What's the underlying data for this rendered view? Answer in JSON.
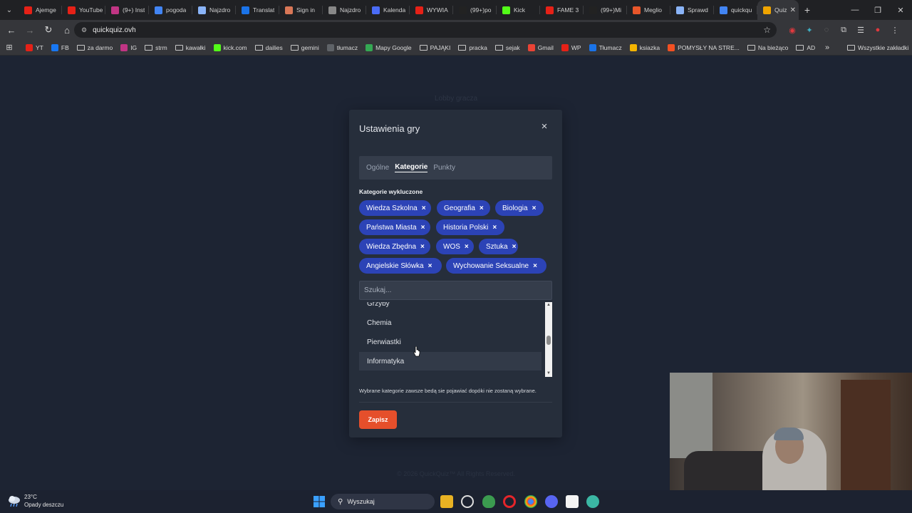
{
  "browser": {
    "tabs": [
      {
        "title": "Ajemge",
        "icon": "youtube-icon",
        "color": "#e62117"
      },
      {
        "title": "YouTube",
        "icon": "youtube-icon",
        "color": "#e62117"
      },
      {
        "title": "(9+) Inst",
        "icon": "instagram-icon",
        "color": "#c13584"
      },
      {
        "title": "pogoda",
        "icon": "google-icon",
        "color": "#4285f4"
      },
      {
        "title": "Najzdro",
        "icon": "gemini-icon",
        "color": "#8ab4f8"
      },
      {
        "title": "Translat",
        "icon": "translate-icon",
        "color": "#1a73e8"
      },
      {
        "title": "Sign in",
        "icon": "asterisk-icon",
        "color": "#d97757"
      },
      {
        "title": "Najzdro",
        "icon": "openai-icon",
        "color": "#888888"
      },
      {
        "title": "Kalenda",
        "icon": "calendar-icon",
        "color": "#4a6cf7"
      },
      {
        "title": "WYWIA",
        "icon": "youtube-icon",
        "color": "#e62117"
      },
      {
        "title": "(99+)po",
        "icon": "tiktok-icon",
        "color": "#222222"
      },
      {
        "title": "Kick",
        "icon": "kick-icon",
        "color": "#53fc18"
      },
      {
        "title": "FAME 3",
        "icon": "youtube-icon",
        "color": "#e62117"
      },
      {
        "title": "(99+)Mi",
        "icon": "tiktok-icon",
        "color": "#222222"
      },
      {
        "title": "Meglio",
        "icon": "letter-c-icon",
        "color": "#e8562a"
      },
      {
        "title": "Sprawd",
        "icon": "gemini-icon",
        "color": "#8ab4f8"
      },
      {
        "title": "quickqu",
        "icon": "google-icon",
        "color": "#4285f4"
      },
      {
        "title": "Quiz",
        "icon": "question-icon",
        "color": "#f0a500",
        "active": true
      }
    ],
    "address": "quickquiz.ovh",
    "bookmarks": [
      {
        "label": "YT",
        "icon": "youtube-icon",
        "color": "#e62117"
      },
      {
        "label": "FB",
        "icon": "facebook-icon",
        "color": "#1877f2"
      },
      {
        "label": "za darmo",
        "icon": "folder-icon"
      },
      {
        "label": "IG",
        "icon": "instagram-icon",
        "color": "#c13584"
      },
      {
        "label": "strm",
        "icon": "folder-icon"
      },
      {
        "label": "kawałki",
        "icon": "folder-icon"
      },
      {
        "label": "kick.com",
        "icon": "kick-icon",
        "color": "#53fc18"
      },
      {
        "label": "dailies",
        "icon": "folder-icon"
      },
      {
        "label": "gemini",
        "icon": "folder-icon"
      },
      {
        "label": "tłumacz",
        "icon": "translate-icon",
        "color": "#5f6368"
      },
      {
        "label": "Mapy Google",
        "icon": "map-pin-icon",
        "color": "#34a853"
      },
      {
        "label": "PAJĄKI",
        "icon": "folder-icon"
      },
      {
        "label": "pracka",
        "icon": "folder-icon"
      },
      {
        "label": "sejak",
        "icon": "folder-icon"
      },
      {
        "label": "Gmail",
        "icon": "gmail-icon",
        "color": "#ea4335"
      },
      {
        "label": "WP",
        "icon": "wp-icon",
        "color": "#e62117"
      },
      {
        "label": "Tłumacz",
        "icon": "translate-icon",
        "color": "#1a73e8"
      },
      {
        "label": "ksiazka",
        "icon": "grid-icon",
        "color": "#f4b400"
      },
      {
        "label": "POMYSŁY NA STRE...",
        "icon": "microsoft-icon",
        "color": "#f25022"
      },
      {
        "label": "Na bieżąco",
        "icon": "folder-icon"
      },
      {
        "label": "AD",
        "icon": "folder-icon"
      }
    ],
    "all_bookmarks": "Wszystkie zakładki"
  },
  "page": {
    "lobby_title": "Lobby gracza",
    "footer": "© 2026 QuickQuiz™ All Rights Reserved."
  },
  "modal": {
    "title": "Ustawienia gry",
    "tabs": [
      {
        "label": "Ogólne",
        "active": false
      },
      {
        "label": "Kategorie",
        "active": true
      },
      {
        "label": "Punkty",
        "active": false
      }
    ],
    "excluded_label": "Kategorie wykluczone",
    "chips": [
      "Wiedza Szkolna",
      "Geografia",
      "Biologia",
      "Państwa Miasta",
      "Historia Polski",
      "Wiedza Zbędna",
      "WOS",
      "Sztuka",
      "Angielskie Słówka",
      "Wychowanie Seksualne"
    ],
    "search_placeholder": "Szukaj...",
    "options": [
      "Grzyby",
      "Chemia",
      "Pierwiastki",
      "Informatyka"
    ],
    "hovered_option": "Informatyka",
    "hint": "Wybrane kategorie zawsze bedą sie pojawiać dopóki nie zostaną wybrane.",
    "save_label": "Zapisz",
    "accent_chip": "#2c43b6",
    "accent_save": "#e54f2b"
  },
  "taskbar": {
    "temperature": "23°C",
    "weather": "Opady deszczu",
    "search_label": "Wyszukaj"
  }
}
